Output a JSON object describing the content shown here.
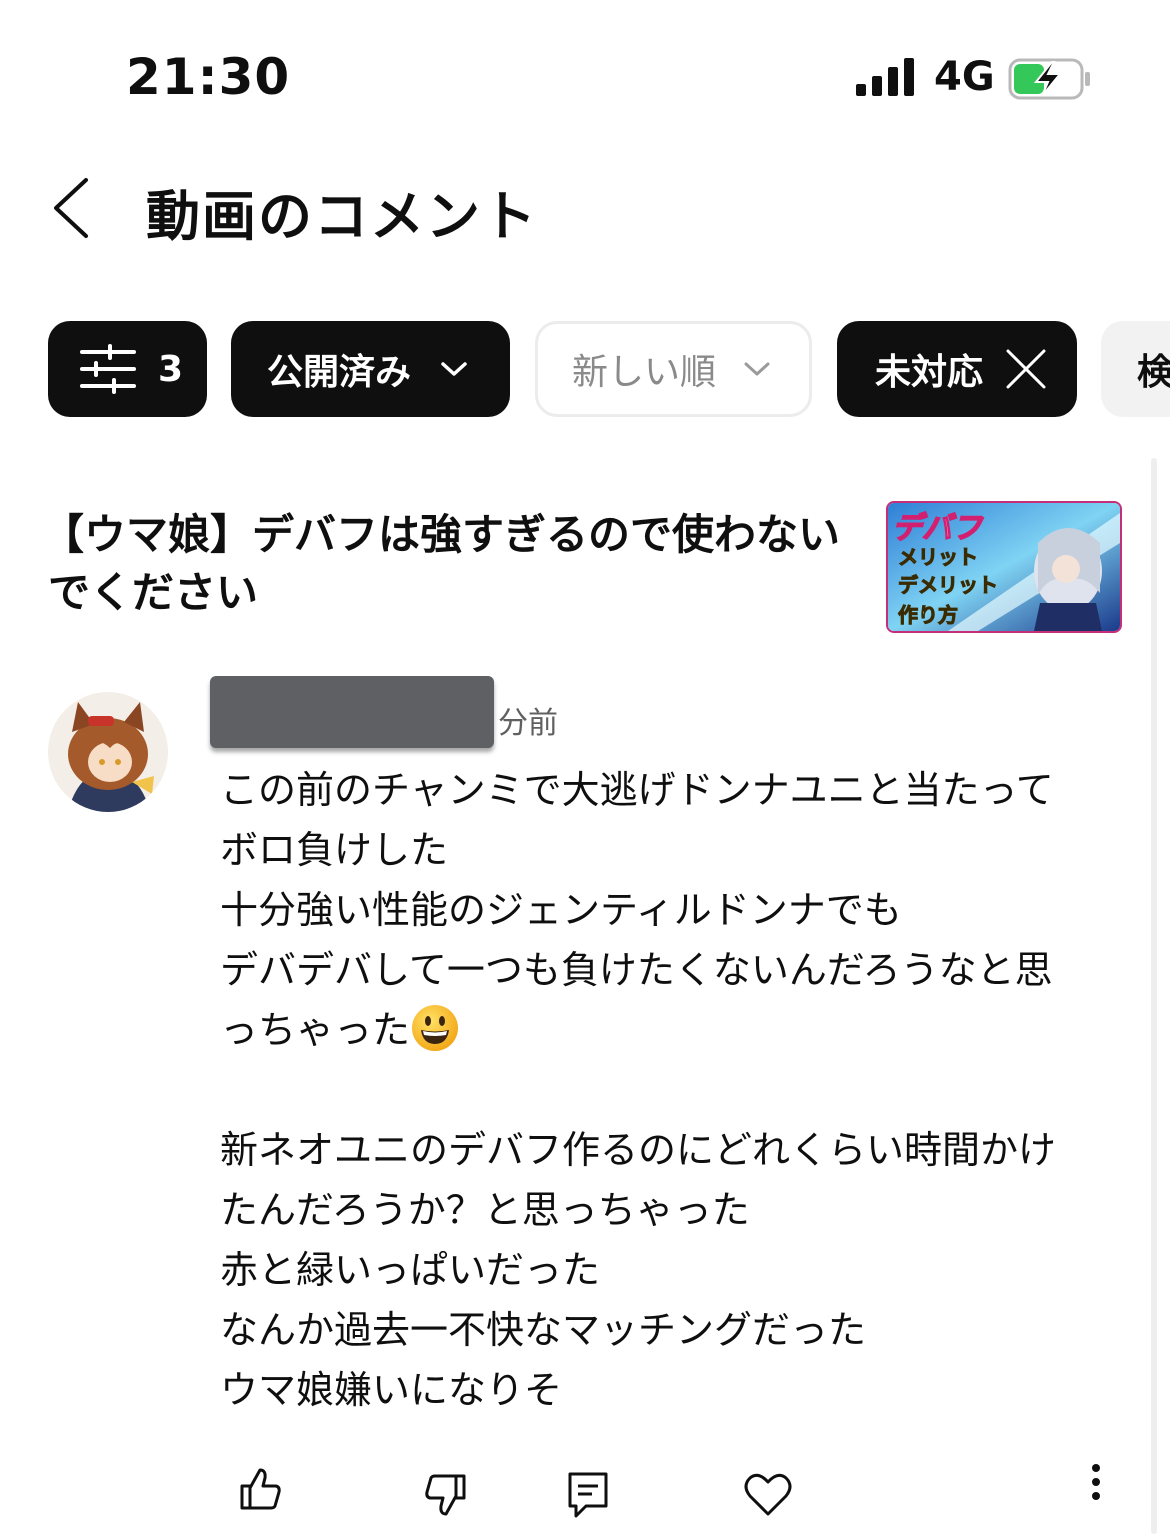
{
  "status_bar": {
    "time": "21:30",
    "network": "4G",
    "battery_color": "#34c759"
  },
  "header": {
    "title": "動画のコメント"
  },
  "filters": {
    "filter_count": "3",
    "published": "公開済み",
    "sort": "新しい順",
    "unresponded": "未対応",
    "search_partial": "検"
  },
  "video": {
    "title_line1": "【ウマ娘】デバフは強すぎるので使わない",
    "title_line2": "でください",
    "thumbnail_text": [
      "デバフ",
      "メリット",
      "デメリット",
      "作り方"
    ]
  },
  "comment": {
    "time_ago": "分前",
    "lines": [
      "この前のチャンミで大逃げドンナユニと当たって",
      "ボロ負けした",
      "十分強い性能のジェンティルドンナでも",
      "デバデバして一つも負けたくないんだろうなと思",
      "っちゃった",
      "",
      "新ネオユニのデバフ作るのにどれくらい時間かけ",
      "たんだろうか？と思っちゃった",
      "赤と緑いっぱいだった",
      "なんか過去一不快なマッチングだった",
      "ウマ娘嫌いになりそ"
    ]
  },
  "actions": {
    "icons": [
      "thumbs-up-icon",
      "thumbs-down-icon",
      "reply-icon",
      "heart-icon",
      "more-icon"
    ]
  }
}
